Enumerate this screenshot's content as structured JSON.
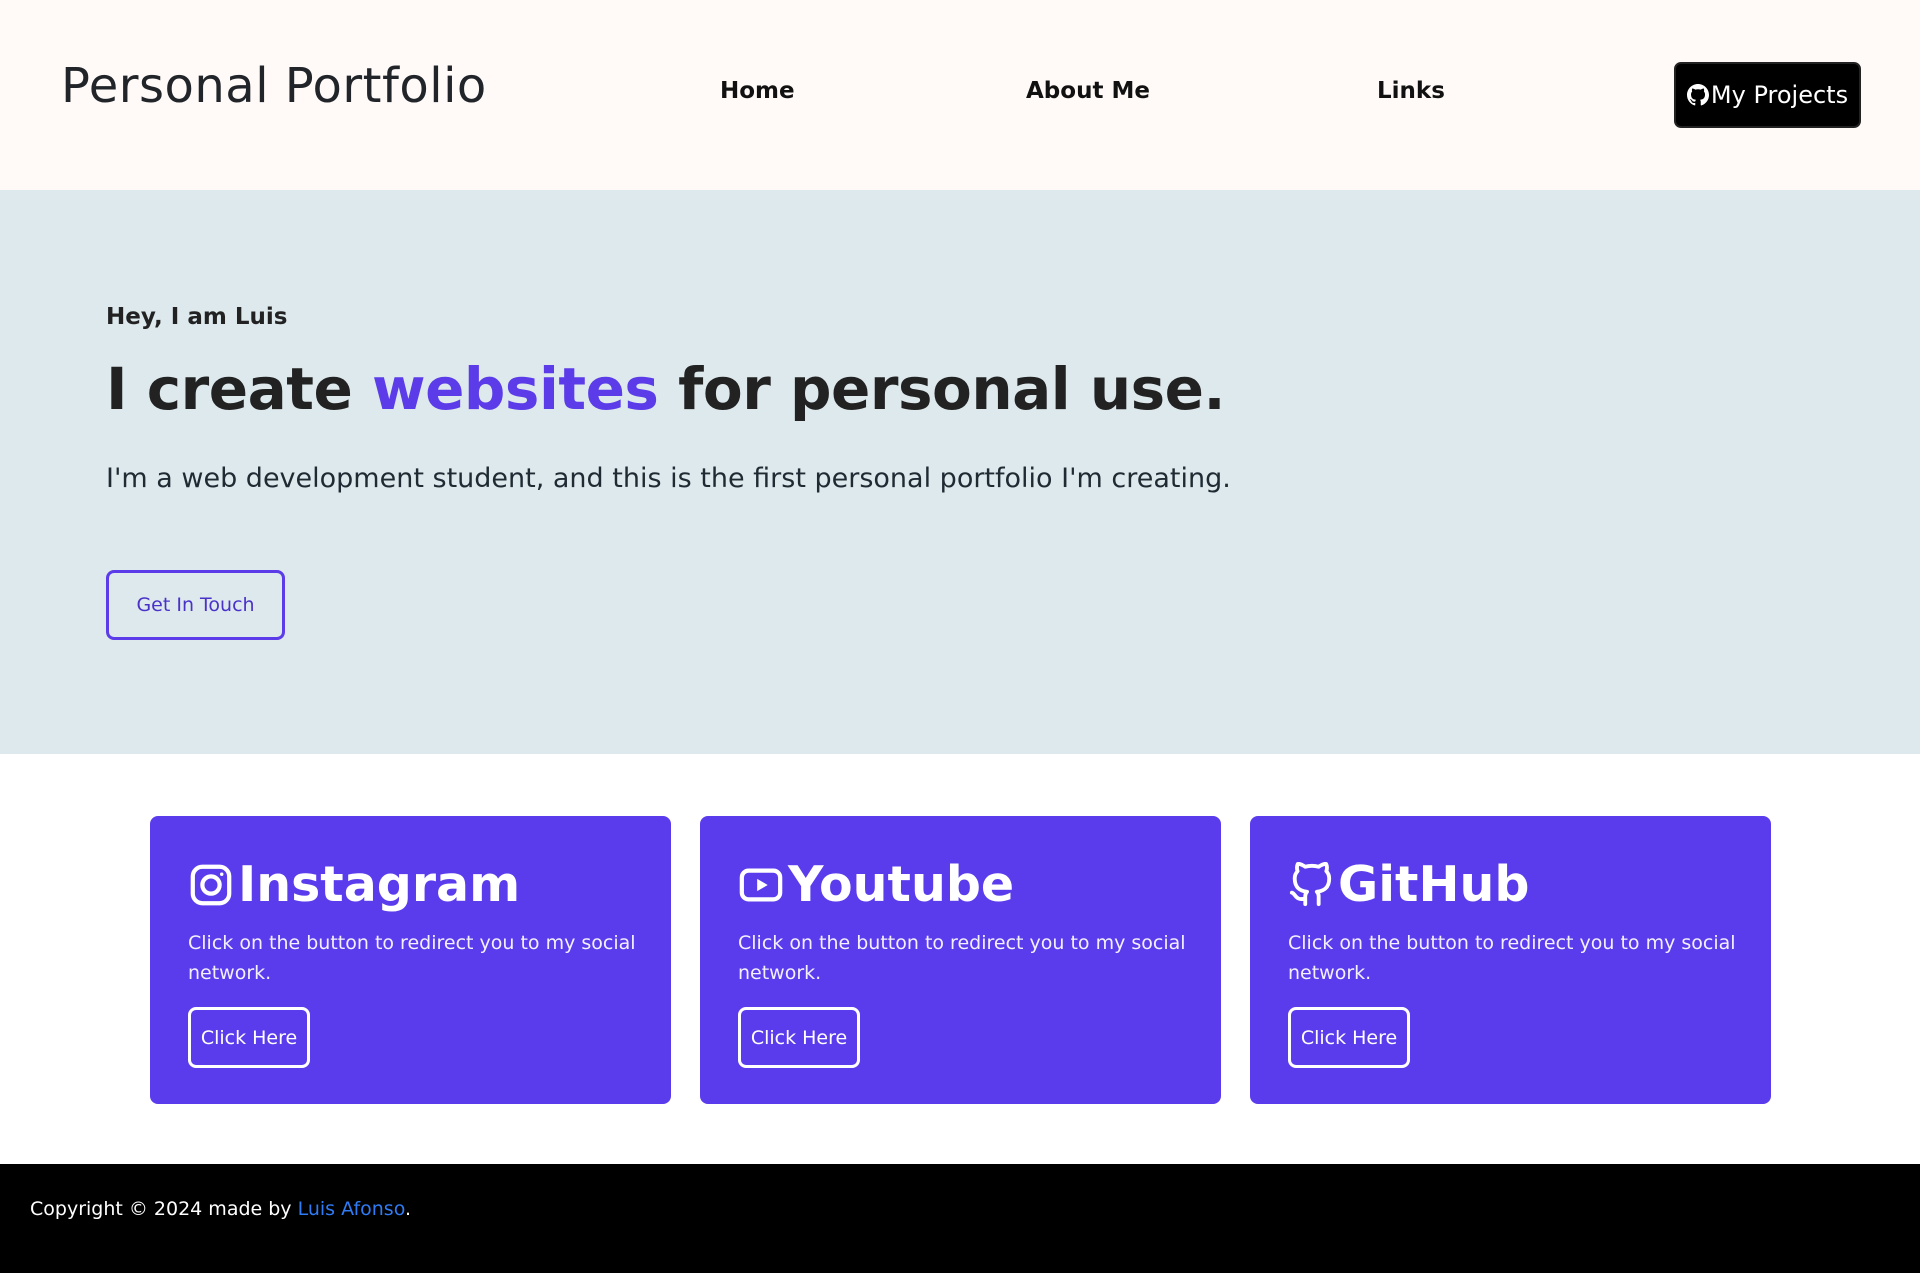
{
  "navbar": {
    "brand": "Personal Portfolio",
    "links": [
      "Home",
      "About Me",
      "Links"
    ],
    "projects_button": "My Projects",
    "projects_icon": "github-icon"
  },
  "hero": {
    "greeting": "Hey, I am Luis",
    "title_before": "I create ",
    "title_accent": "websites",
    "title_after": " for personal use.",
    "description": "I'm a web development student, and this is the first personal portfolio I'm creating.",
    "cta": "Get In Touch",
    "accent_color": "#5b3ce8"
  },
  "cards": [
    {
      "title": "Instagram",
      "icon": "instagram-icon",
      "text": "Click on the button to redirect you to my social network.",
      "button": "Click Here"
    },
    {
      "title": "Youtube",
      "icon": "youtube-icon",
      "text": "Click on the button to redirect you to my social network.",
      "button": "Click Here"
    },
    {
      "title": "GitHub",
      "icon": "github-icon",
      "text": "Click on the button to redirect you to my social network.",
      "button": "Click Here"
    }
  ],
  "footer": {
    "prefix": "Copyright © 2024 made by ",
    "author": "Luis Afonso",
    "suffix": "."
  }
}
